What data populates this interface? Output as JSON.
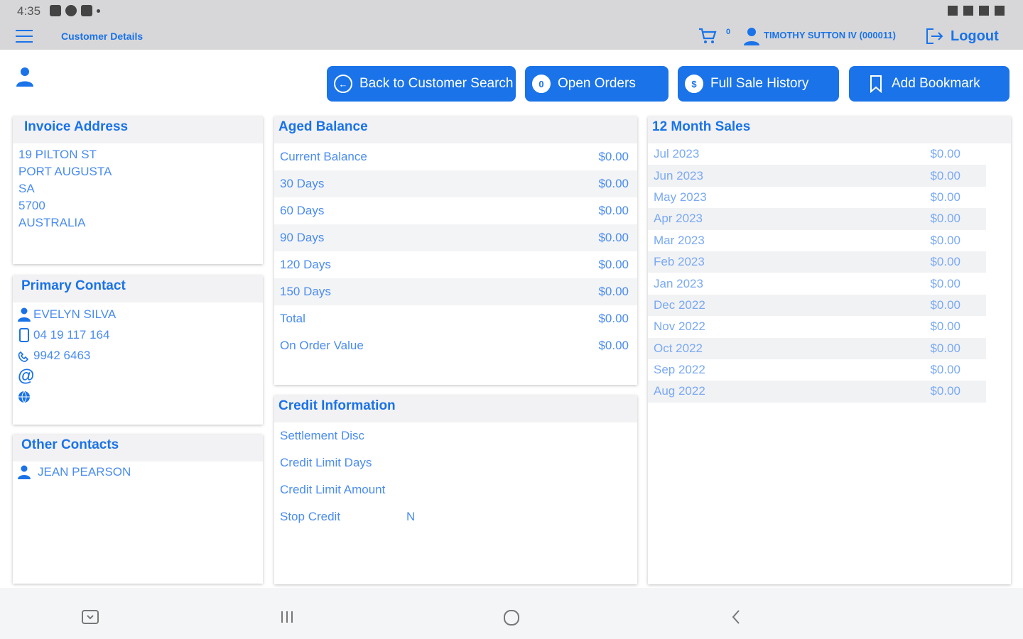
{
  "status": {
    "time": "4:35"
  },
  "header": {
    "title": "Customer Details",
    "cart_count": "0",
    "user": "TIMOTHY SUTTON IV (000011)",
    "logout": "Logout"
  },
  "actions": {
    "back": "Back to Customer Search",
    "open_orders": "Open Orders",
    "open_orders_count": "0",
    "history": "Full Sale History",
    "history_badge": "$",
    "bookmark": "Add Bookmark"
  },
  "invoice": {
    "title": "Invoice Address",
    "lines": [
      "19 PILTON ST",
      "PORT AUGUSTA",
      "SA",
      "5700",
      "AUSTRALIA"
    ]
  },
  "primary_contact": {
    "title": "Primary Contact",
    "name": "EVELYN SILVA",
    "mobile": "04 19 117 164",
    "phone": "9942 6463",
    "email_symbol": "@"
  },
  "other_contacts": {
    "title": "Other Contacts",
    "names": [
      "JEAN PEARSON"
    ]
  },
  "aged": {
    "title": "Aged Balance",
    "rows": [
      {
        "label": "Current Balance",
        "value": "$0.00"
      },
      {
        "label": "30 Days",
        "value": "$0.00"
      },
      {
        "label": "60 Days",
        "value": "$0.00"
      },
      {
        "label": "90 Days",
        "value": "$0.00"
      },
      {
        "label": "120 Days",
        "value": "$0.00"
      },
      {
        "label": "150 Days",
        "value": "$0.00"
      },
      {
        "label": "Total",
        "value": "$0.00"
      },
      {
        "label": "On Order Value",
        "value": "$0.00"
      }
    ]
  },
  "credit": {
    "title": "Credit Information",
    "rows": [
      {
        "label": "Settlement Disc",
        "value": ""
      },
      {
        "label": "Credit Limit Days",
        "value": ""
      },
      {
        "label": "Credit Limit Amount",
        "value": ""
      },
      {
        "label": "Stop Credit",
        "value": "N"
      }
    ]
  },
  "sales": {
    "title": "12 Month Sales",
    "rows": [
      {
        "month": "Jul 2023",
        "value": "$0.00"
      },
      {
        "month": "Jun 2023",
        "value": "$0.00"
      },
      {
        "month": "May 2023",
        "value": "$0.00"
      },
      {
        "month": "Apr 2023",
        "value": "$0.00"
      },
      {
        "month": "Mar 2023",
        "value": "$0.00"
      },
      {
        "month": "Feb 2023",
        "value": "$0.00"
      },
      {
        "month": "Jan 2023",
        "value": "$0.00"
      },
      {
        "month": "Dec 2022",
        "value": "$0.00"
      },
      {
        "month": "Nov 2022",
        "value": "$0.00"
      },
      {
        "month": "Oct 2022",
        "value": "$0.00"
      },
      {
        "month": "Sep 2022",
        "value": "$0.00"
      },
      {
        "month": "Aug 2022",
        "value": "$0.00"
      }
    ]
  },
  "colors": {
    "accent": "#1a73e8",
    "text_light": "#4a8cf0",
    "bar_bg": "#d7d7d9"
  }
}
